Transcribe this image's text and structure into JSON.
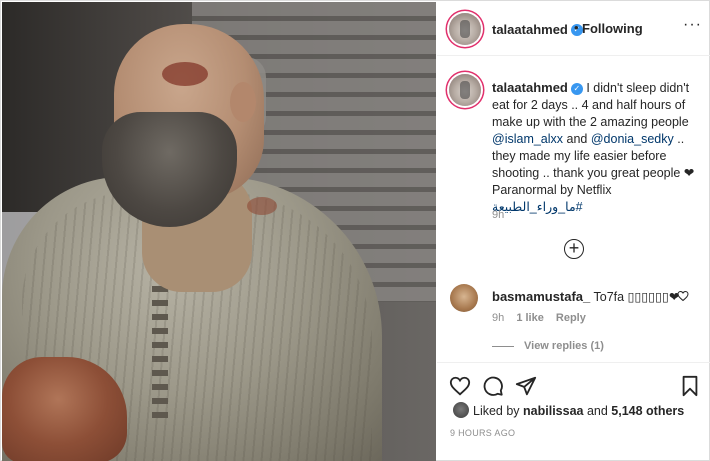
{
  "post": {
    "username": "talaatahmed",
    "verified_mark": "✓",
    "separator": "•",
    "follow_status": "Following",
    "more_label": "···",
    "caption_parts": {
      "text_1": "I didn't sleep didn't eat for 2 days .. 4 and half hours of make up with the 2 amazing people ",
      "mention_1": "@islam_alxx",
      "text_2": " and ",
      "mention_2": "@donia_sedky",
      "text_3": " .. they made my life easier before shooting .. thank you great people ❤ Paranormal by Netflix ",
      "hashtag": "#ما_وراء_الطبيعة"
    },
    "caption_time": "9h",
    "load_more_label": "+"
  },
  "comment": {
    "username": "basmamustafa_",
    "text": "To7fa ▯▯▯▯▯▯❤",
    "time": "9h",
    "likes": "1 like",
    "reply": "Reply",
    "view_replies": "View replies (1)"
  },
  "likes": {
    "prefix": "Liked by ",
    "user": "nabilissaa",
    "middle": " and ",
    "count": "5,148 others"
  },
  "posted_ago": "9 HOURS AGO",
  "icons": {
    "like": "heart-icon",
    "comment": "comment-icon",
    "share": "share-icon",
    "save": "bookmark-icon"
  },
  "colors": {
    "link": "#00376b",
    "verified": "#3897f0",
    "muted": "#8e8e8e"
  }
}
